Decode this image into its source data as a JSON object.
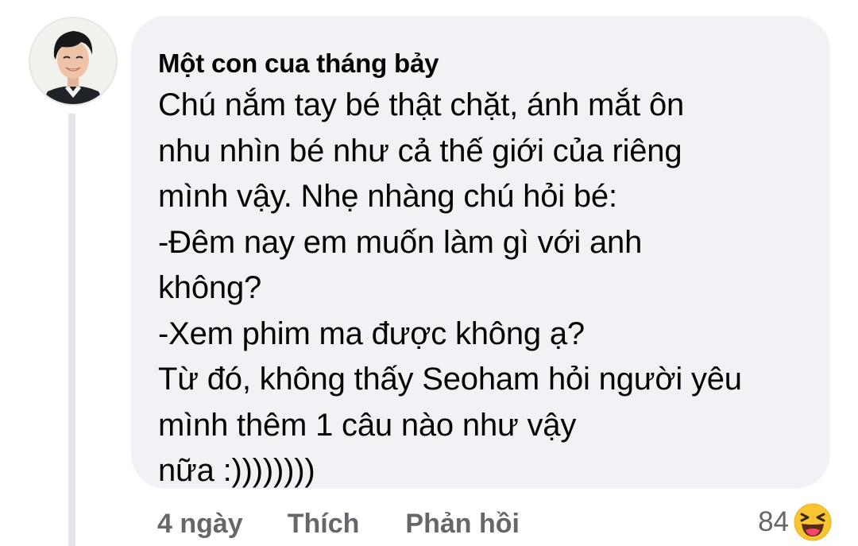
{
  "comment": {
    "author": "Một con cua tháng bảy",
    "text_lines": [
      "Chú nắm tay bé thật chặt, ánh mắt ôn",
      "nhu nhìn bé như cả thế giới của riêng",
      "mình vậy. Nhẹ nhàng chú hỏi bé:",
      "-Đêm nay em muốn làm gì với anh",
      "không?",
      "-Xem phim ma được không ạ?",
      "Từ đó, không thấy Seoham hỏi người yêu",
      "mình thêm 1 câu nào như vậy",
      "nữa :))))))))"
    ]
  },
  "actions": {
    "time": "4 ngày",
    "like": "Thích",
    "reply": "Phản hồi"
  },
  "reactions": {
    "count": "84",
    "icon": "haha-emoji-icon"
  },
  "colors": {
    "bubble": "#f0f2f5",
    "secondary_text": "#65676b",
    "thread_line": "#e4e6ea",
    "emoji_yellow": "#f7c531"
  }
}
